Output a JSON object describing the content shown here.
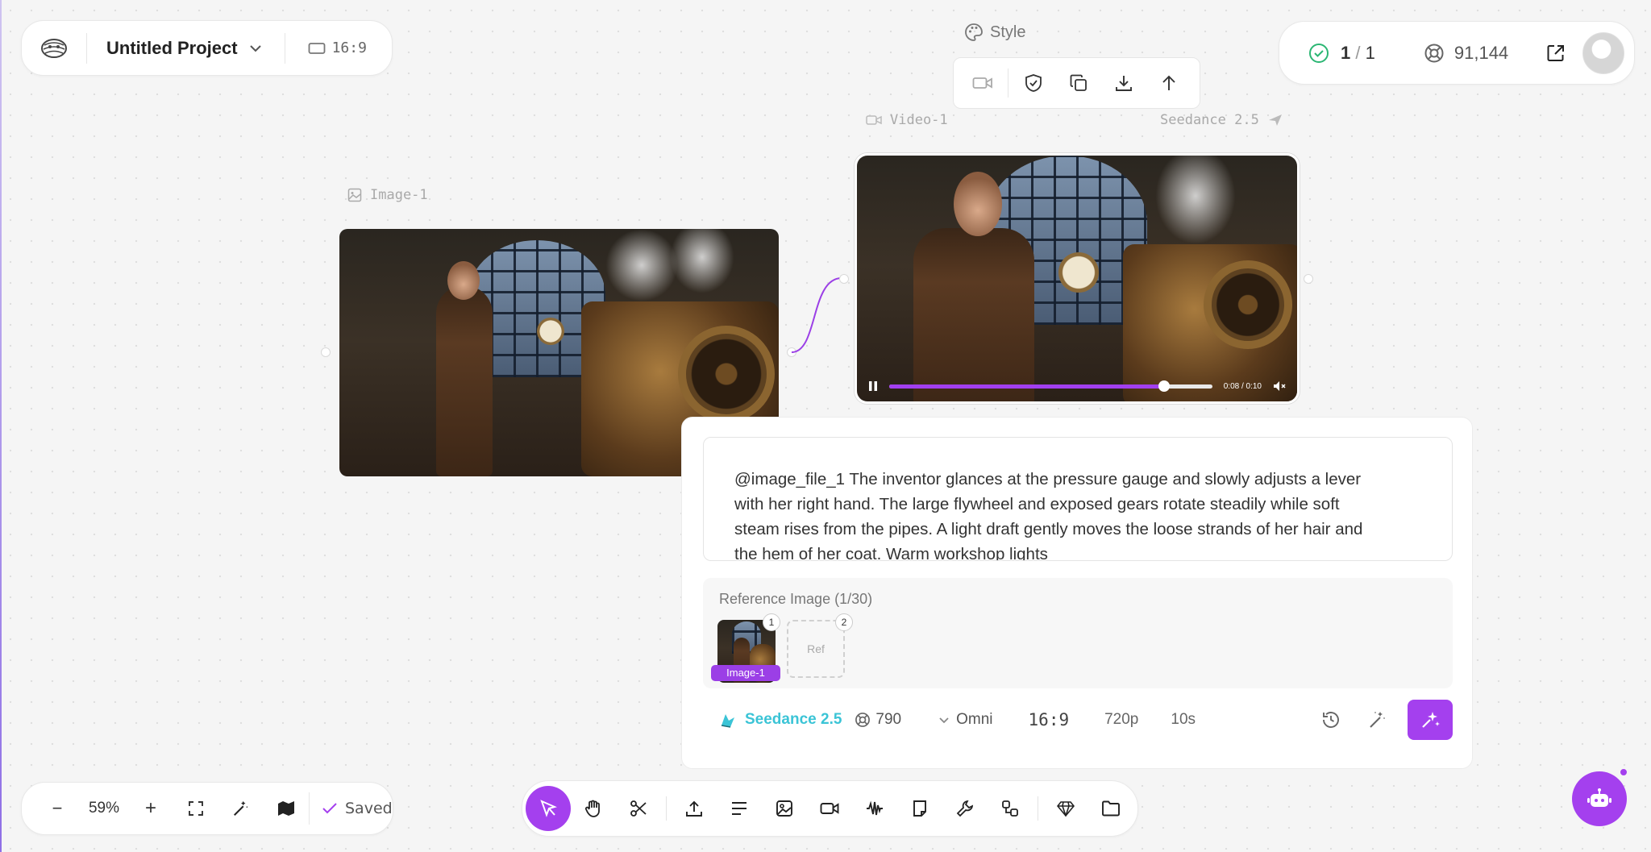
{
  "project": {
    "title": "Untitled Project",
    "aspect_ratio": "16:9",
    "logo_icon": "film-reel-logo-icon"
  },
  "style_label": "Style",
  "node_toolbar": {
    "icons": [
      "video-camera-icon",
      "shield-check-icon",
      "copy-icon",
      "download-icon",
      "arrow-up-icon"
    ]
  },
  "status": {
    "tasks_done": "1",
    "tasks_sep": "/",
    "tasks_total": "1",
    "credits": "91,144"
  },
  "nodes": {
    "image": {
      "label": "Image-1"
    },
    "video": {
      "label": "Video-1",
      "model": "Seedance 2.5",
      "time": "0:08 / 0:10",
      "progress": 0.85
    }
  },
  "prompt": {
    "text": "@image_file_1 The inventor glances at the pressure gauge and slowly adjusts a lever with her right hand. The large flywheel and exposed gears rotate steadily while soft steam rises from the pipes. A light draft gently moves the loose strands of her hair and the hem of her coat. Warm workshop lights"
  },
  "reference": {
    "title": "Reference Image (1/30)",
    "slot1_number": "1",
    "slot1_tag": "Image-1",
    "slot2_number": "2",
    "slot2_label": "Ref"
  },
  "settings": {
    "model": "Seedance 2.5",
    "cost": "790",
    "mode": "Omni",
    "aspect": "16:9",
    "resolution": "720p",
    "duration": "10s"
  },
  "zoom": {
    "minus": "−",
    "level": "59%",
    "plus": "+",
    "save_state": "Saved"
  },
  "bottom_toolbar": {
    "tools": [
      "cursor-icon",
      "hand-icon",
      "scissors-icon",
      "upload-icon",
      "text-align-icon",
      "image-icon",
      "video-icon",
      "audio-wave-icon",
      "note-icon",
      "wrench-icon",
      "nodes-icon",
      "gem-icon",
      "folder-icon"
    ]
  },
  "colors": {
    "accent": "#a440ee",
    "model_cyan": "#3bc4d6",
    "success_green": "#2bb673"
  }
}
